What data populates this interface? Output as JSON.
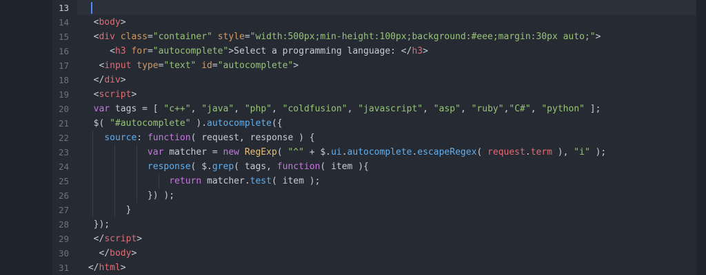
{
  "editor": {
    "theme_colors": {
      "background": "#252a33",
      "tag": "#e06c75",
      "attribute": "#d19a66",
      "string": "#98c379",
      "keyword": "#c678dd",
      "function": "#61afef"
    },
    "current_line": 13,
    "lines": [
      {
        "n": "13",
        "tokens": []
      },
      {
        "n": "14",
        "tokens": [
          [
            "pl",
            "  "
          ],
          [
            "pl",
            "<"
          ],
          [
            "tag",
            "body"
          ],
          [
            "pl",
            ">"
          ]
        ]
      },
      {
        "n": "15",
        "tokens": [
          [
            "pl",
            "  "
          ],
          [
            "pl",
            "<"
          ],
          [
            "tag",
            "div"
          ],
          [
            "pl",
            " "
          ],
          [
            "attr",
            "class"
          ],
          [
            "pl",
            "="
          ],
          [
            "str",
            "\"container\""
          ],
          [
            "pl",
            " "
          ],
          [
            "attr",
            "style"
          ],
          [
            "pl",
            "="
          ],
          [
            "str",
            "\"width:500px;min-height:100px;background:#eee;margin:30px auto;\""
          ],
          [
            "pl",
            ">"
          ]
        ]
      },
      {
        "n": "16",
        "tokens": [
          [
            "pl",
            "     "
          ],
          [
            "pl",
            "<"
          ],
          [
            "tag",
            "h3"
          ],
          [
            "pl",
            " "
          ],
          [
            "attr",
            "for"
          ],
          [
            "pl",
            "="
          ],
          [
            "str",
            "\"autocomplete\""
          ],
          [
            "pl",
            ">Select a programming language: </"
          ],
          [
            "tag",
            "h3"
          ],
          [
            "pl",
            ">"
          ]
        ]
      },
      {
        "n": "17",
        "tokens": [
          [
            "pl",
            "   "
          ],
          [
            "pl",
            "<"
          ],
          [
            "tag",
            "input"
          ],
          [
            "pl",
            " "
          ],
          [
            "attr",
            "type"
          ],
          [
            "pl",
            "="
          ],
          [
            "str",
            "\"text\""
          ],
          [
            "pl",
            " "
          ],
          [
            "attr",
            "id"
          ],
          [
            "pl",
            "="
          ],
          [
            "str",
            "\"autocomplete\""
          ],
          [
            "pl",
            ">"
          ]
        ]
      },
      {
        "n": "18",
        "tokens": [
          [
            "pl",
            "  </"
          ],
          [
            "tag",
            "div"
          ],
          [
            "pl",
            ">"
          ]
        ]
      },
      {
        "n": "19",
        "tokens": [
          [
            "pl",
            "  <"
          ],
          [
            "tag",
            "script"
          ],
          [
            "pl",
            ">"
          ]
        ]
      },
      {
        "n": "20",
        "tokens": [
          [
            "pl",
            "  "
          ],
          [
            "kw",
            "var"
          ],
          [
            "pl",
            " tags = [ "
          ],
          [
            "str",
            "\"c++\""
          ],
          [
            "pl",
            ", "
          ],
          [
            "str",
            "\"java\""
          ],
          [
            "pl",
            ", "
          ],
          [
            "str",
            "\"php\""
          ],
          [
            "pl",
            ", "
          ],
          [
            "str",
            "\"coldfusion\""
          ],
          [
            "pl",
            ", "
          ],
          [
            "str",
            "\"javascript\""
          ],
          [
            "pl",
            ", "
          ],
          [
            "str",
            "\"asp\""
          ],
          [
            "pl",
            ", "
          ],
          [
            "str",
            "\"ruby\""
          ],
          [
            "pl",
            ","
          ],
          [
            "str",
            "\"C#\""
          ],
          [
            "pl",
            ", "
          ],
          [
            "str",
            "\"python\""
          ],
          [
            "pl",
            " ];"
          ]
        ]
      },
      {
        "n": "21",
        "tokens": [
          [
            "pl",
            "  $( "
          ],
          [
            "str",
            "\"#autocomplete\""
          ],
          [
            "pl",
            " )."
          ],
          [
            "fn",
            "autocomplete"
          ],
          [
            "pl",
            "({"
          ]
        ]
      },
      {
        "n": "22",
        "tokens": [
          [
            "pl",
            "    "
          ],
          [
            "fn",
            "source"
          ],
          [
            "pl",
            ": "
          ],
          [
            "kw",
            "function"
          ],
          [
            "pl",
            "( request, response ) {"
          ]
        ]
      },
      {
        "n": "23",
        "tokens": [
          [
            "pl",
            "            "
          ],
          [
            "kw",
            "var"
          ],
          [
            "pl",
            " matcher = "
          ],
          [
            "kw",
            "new"
          ],
          [
            "pl",
            " "
          ],
          [
            "cls",
            "RegExp"
          ],
          [
            "pl",
            "( "
          ],
          [
            "str",
            "\"^\""
          ],
          [
            "pl",
            " + $."
          ],
          [
            "fn",
            "ui"
          ],
          [
            "pl",
            "."
          ],
          [
            "fn",
            "autocomplete"
          ],
          [
            "pl",
            "."
          ],
          [
            "fn",
            "escapeRegex"
          ],
          [
            "pl",
            "( "
          ],
          [
            "prop",
            "request"
          ],
          [
            "pl",
            "."
          ],
          [
            "prop",
            "term"
          ],
          [
            "pl",
            " ), "
          ],
          [
            "str",
            "\"i\""
          ],
          [
            "pl",
            " );"
          ]
        ]
      },
      {
        "n": "24",
        "tokens": [
          [
            "pl",
            "            "
          ],
          [
            "fn",
            "response"
          ],
          [
            "pl",
            "( $."
          ],
          [
            "fn",
            "grep"
          ],
          [
            "pl",
            "( tags, "
          ],
          [
            "kw",
            "function"
          ],
          [
            "pl",
            "( item ){"
          ]
        ]
      },
      {
        "n": "25",
        "tokens": [
          [
            "pl",
            "                "
          ],
          [
            "kw",
            "return"
          ],
          [
            "pl",
            " matcher."
          ],
          [
            "fn",
            "test"
          ],
          [
            "pl",
            "( item );"
          ]
        ]
      },
      {
        "n": "26",
        "tokens": [
          [
            "pl",
            "            }) );"
          ]
        ]
      },
      {
        "n": "27",
        "tokens": [
          [
            "pl",
            "        }"
          ]
        ]
      },
      {
        "n": "28",
        "tokens": [
          [
            "pl",
            "  });"
          ]
        ]
      },
      {
        "n": "29",
        "tokens": [
          [
            "pl",
            "  </"
          ],
          [
            "tag",
            "script"
          ],
          [
            "pl",
            ">"
          ]
        ]
      },
      {
        "n": "30",
        "tokens": [
          [
            "pl",
            "   </"
          ],
          [
            "tag",
            "body"
          ],
          [
            "pl",
            ">"
          ]
        ]
      },
      {
        "n": "31",
        "tokens": [
          [
            "pl",
            " </"
          ],
          [
            "tag",
            "html"
          ],
          [
            "pl",
            ">"
          ]
        ]
      }
    ]
  }
}
